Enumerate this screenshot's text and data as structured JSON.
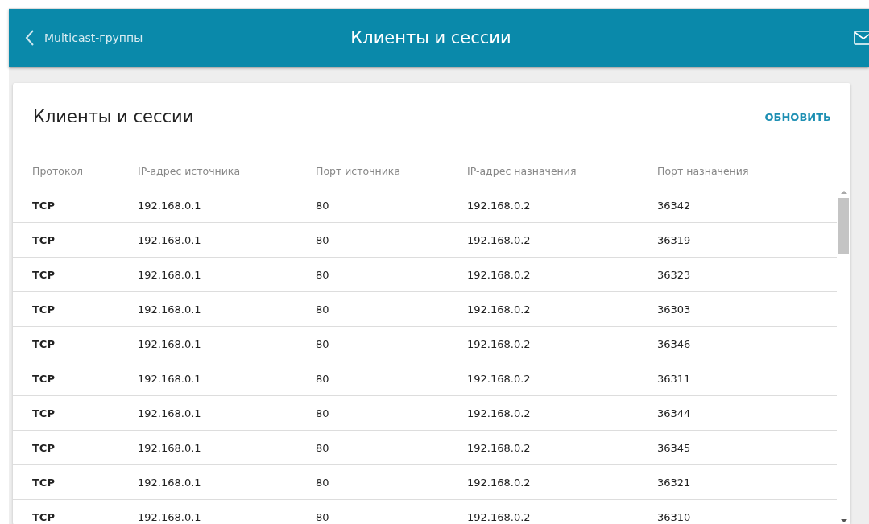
{
  "header": {
    "back_label": "Multicast-группы",
    "title": "Клиенты и сессии"
  },
  "card": {
    "title": "Клиенты и сессии",
    "refresh_button": "ОБНОВИТЬ"
  },
  "table": {
    "columns": [
      "Протокол",
      "IP-адрес источника",
      "Порт источника",
      "IP-адрес назначения",
      "Порт назначения"
    ],
    "rows": [
      [
        "TCP",
        "192.168.0.1",
        "80",
        "192.168.0.2",
        "36342"
      ],
      [
        "TCP",
        "192.168.0.1",
        "80",
        "192.168.0.2",
        "36319"
      ],
      [
        "TCP",
        "192.168.0.1",
        "80",
        "192.168.0.2",
        "36323"
      ],
      [
        "TCP",
        "192.168.0.1",
        "80",
        "192.168.0.2",
        "36303"
      ],
      [
        "TCP",
        "192.168.0.1",
        "80",
        "192.168.0.2",
        "36346"
      ],
      [
        "TCP",
        "192.168.0.1",
        "80",
        "192.168.0.2",
        "36311"
      ],
      [
        "TCP",
        "192.168.0.1",
        "80",
        "192.168.0.2",
        "36344"
      ],
      [
        "TCP",
        "192.168.0.1",
        "80",
        "192.168.0.2",
        "36345"
      ],
      [
        "TCP",
        "192.168.0.1",
        "80",
        "192.168.0.2",
        "36321"
      ],
      [
        "TCP",
        "192.168.0.1",
        "80",
        "192.168.0.2",
        "36310"
      ]
    ]
  }
}
